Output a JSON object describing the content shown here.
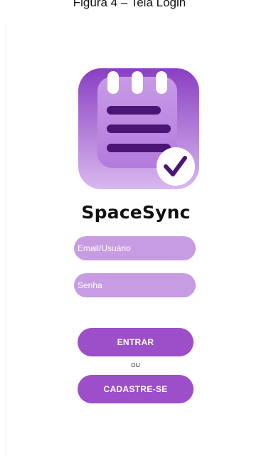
{
  "caption": "Figura 4 – Tela Login",
  "app": {
    "name": "SpaceSync",
    "logo_icon": "notepad-checkmark-icon"
  },
  "login": {
    "email_placeholder": "Email/Usuário",
    "password_placeholder": "Senha",
    "enter_label": "ENTRAR",
    "or_label": "OU",
    "signup_label": "CADASTRE-SE"
  },
  "colors": {
    "primary": "#9c4fc9",
    "field_fill": "#c79ce3",
    "logo_bg_top": "#8a3fc2",
    "logo_bg_bottom": "#d7b4ee",
    "notepad_bars": "#4a1575"
  }
}
